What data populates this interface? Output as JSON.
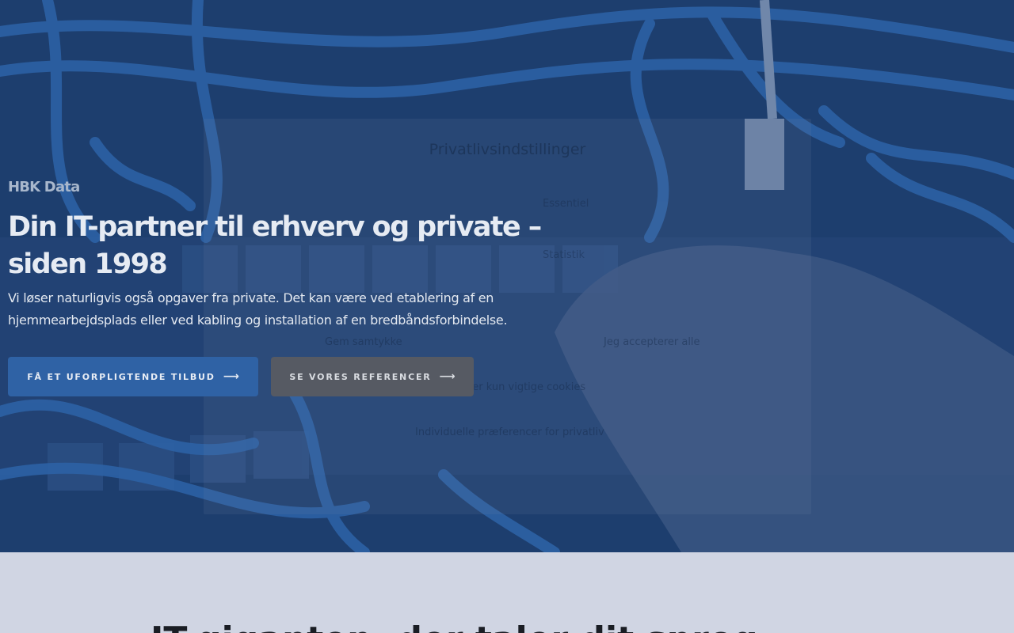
{
  "hero": {
    "eyebrow": "HBK Data",
    "headline": "Din IT-partner til erhverv og private – siden 1998",
    "lead": "Vi løser naturligvis også opgaver fra private. Det kan være ved etablering af en hjemmearbejdsplads eller ved kabling og installation af en bredbåndsforbindelse.",
    "primary_button": "Få et uforpligtende tilbud",
    "secondary_button": "Se vores referencer",
    "arrow_glyph": "⟶",
    "overlay_color": "#183a6e",
    "accent_color": "#2f62a5"
  },
  "privacy_dialog": {
    "title": "Privatlivsindstillinger",
    "essential_label": "Essentiel",
    "statistics_label": "Statistik",
    "save_label": "Gem samtykke",
    "accept_all_label": "Jeg accepterer alle",
    "accept_essential_label": "Accepter kun vigtige cookies",
    "individual_label": "Individuelle præferencer for privatliv"
  },
  "section2": {
    "heading_partial": "IT-giganten, der taler dit sprog"
  }
}
